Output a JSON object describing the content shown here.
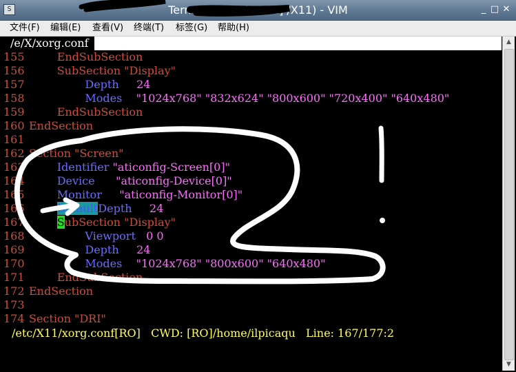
{
  "window": {
    "title": "Terminal - [redacted] /X11) - VIM",
    "icon_glyph": "S",
    "minimize_glyph": "_",
    "maximize_glyph": "□",
    "close_glyph": "✕"
  },
  "menu": [
    {
      "label": "文件(F)"
    },
    {
      "label": "编辑(E)"
    },
    {
      "label": "查看(V)"
    },
    {
      "label": "终端(T)"
    },
    {
      "label": "标签(G)"
    },
    {
      "label": "帮助(H)"
    }
  ],
  "vim": {
    "tab_label": "/e/X/xorg.conf",
    "lines": [
      {
        "n": "155",
        "segments": [
          {
            "t": "        EndSubSection",
            "c": "kw"
          }
        ]
      },
      {
        "n": "156",
        "segments": [
          {
            "t": "        SubSection \"Display\"",
            "c": "kw"
          }
        ]
      },
      {
        "n": "157",
        "segments": [
          {
            "t": "                ",
            "c": ""
          },
          {
            "t": "Depth",
            "c": "opt"
          },
          {
            "t": "     24",
            "c": "num"
          }
        ]
      },
      {
        "n": "158",
        "segments": [
          {
            "t": "                ",
            "c": ""
          },
          {
            "t": "Modes",
            "c": "opt"
          },
          {
            "t": "    \"1024x768\" \"832x624\" \"800x600\" \"720x400\" \"640x480\"",
            "c": "str"
          }
        ]
      },
      {
        "n": "159",
        "segments": [
          {
            "t": "        EndSubSection",
            "c": "kw"
          }
        ]
      },
      {
        "n": "160",
        "segments": [
          {
            "t": "EndSection",
            "c": "kw"
          }
        ]
      },
      {
        "n": "161",
        "segments": []
      },
      {
        "n": "162",
        "segments": [
          {
            "t": "Section \"Screen\"",
            "c": "kw"
          }
        ]
      },
      {
        "n": "163",
        "segments": [
          {
            "t": "        ",
            "c": ""
          },
          {
            "t": "Identifier",
            "c": "opt"
          },
          {
            "t": " \"aticonfig-Screen[0]\"",
            "c": "str"
          }
        ]
      },
      {
        "n": "164",
        "segments": [
          {
            "t": "        ",
            "c": ""
          },
          {
            "t": "Device",
            "c": "opt"
          },
          {
            "t": "      \"aticonfig-Device[0]\"",
            "c": "str"
          }
        ]
      },
      {
        "n": "165",
        "segments": [
          {
            "t": "        ",
            "c": ""
          },
          {
            "t": "Monitor",
            "c": "opt"
          },
          {
            "t": "     \"aticonfig-Monitor[0]\"",
            "c": "str"
          }
        ]
      },
      {
        "n": "166",
        "segments": [
          {
            "t": "        ",
            "c": ""
          },
          {
            "t": "Default",
            "c": "hl-search"
          },
          {
            "t": "Depth",
            "c": "opt"
          },
          {
            "t": "     24",
            "c": "num"
          }
        ]
      },
      {
        "n": "167",
        "segments": [
          {
            "t": "        ",
            "c": ""
          },
          {
            "t": "S",
            "c": "cursor"
          },
          {
            "t": "ubSection \"Display\"",
            "c": "kw"
          }
        ]
      },
      {
        "n": "168",
        "segments": [
          {
            "t": "                ",
            "c": ""
          },
          {
            "t": "Viewport",
            "c": "opt"
          },
          {
            "t": "   0 0",
            "c": "num"
          }
        ]
      },
      {
        "n": "169",
        "segments": [
          {
            "t": "                ",
            "c": ""
          },
          {
            "t": "Depth",
            "c": "opt"
          },
          {
            "t": "     24",
            "c": "num"
          }
        ]
      },
      {
        "n": "170",
        "segments": [
          {
            "t": "                ",
            "c": ""
          },
          {
            "t": "Modes",
            "c": "opt"
          },
          {
            "t": "    \"1024x768\" \"800x600\" \"640x480\"",
            "c": "str"
          }
        ]
      },
      {
        "n": "171",
        "segments": [
          {
            "t": "        EndSubSection",
            "c": "kw"
          }
        ]
      },
      {
        "n": "172",
        "segments": [
          {
            "t": "EndSection",
            "c": "kw"
          }
        ]
      },
      {
        "n": "173",
        "segments": []
      },
      {
        "n": "174",
        "segments": [
          {
            "t": "Section \"DRI\"",
            "c": "kw"
          }
        ]
      }
    ],
    "status": "/etc/X11/xorg.conf[RO]   CWD: [RO]/home/ilpicaqu   Line: 167/177:2"
  },
  "colors": {
    "keyword": "#cd4d3a",
    "option": "#6b6bff",
    "string": "#ff6cff",
    "status": "#ffff55",
    "scribble": "#ffffff"
  }
}
